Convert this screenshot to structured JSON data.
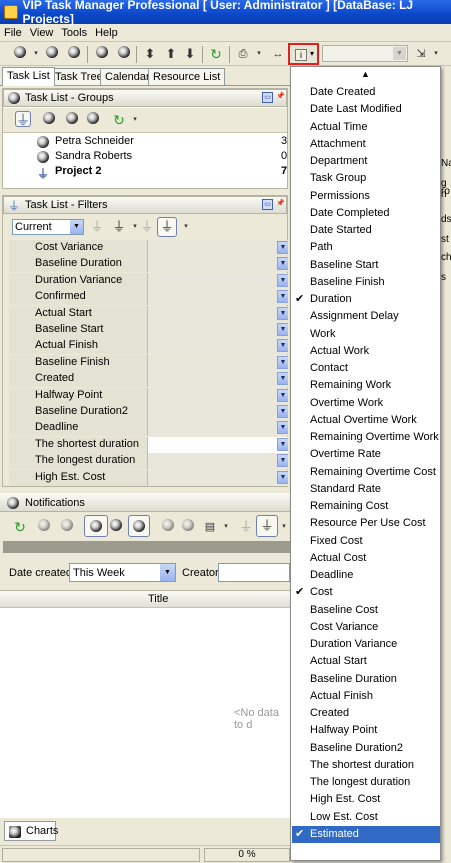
{
  "window": {
    "title": "VIP Task Manager Professional [ User: Administrator ] [DataBase: LJ Projects]"
  },
  "menubar": [
    "File",
    "View",
    "Tools",
    "Help"
  ],
  "tabs": [
    "Task List",
    "Task Tree",
    "Calendar",
    "Resource List"
  ],
  "groups_panel": {
    "title": "Task List - Groups",
    "rows": [
      {
        "name": "Petra Schneider",
        "count": "3"
      },
      {
        "name": "Sandra Roberts",
        "count": "0"
      },
      {
        "name": "Project 2",
        "count": "7"
      }
    ]
  },
  "filters_panel": {
    "title": "Task List - Filters",
    "filter_select": "Current",
    "rows": [
      "Cost Variance",
      "Baseline Duration",
      "Duration Variance",
      "Confirmed",
      "Actual Start",
      "Baseline Start",
      "Actual Finish",
      "Baseline Finish",
      "Created",
      "Halfway Point",
      "Baseline Duration2",
      "Deadline",
      "The shortest duration",
      "The longest duration",
      "High Est. Cost"
    ]
  },
  "notifications": {
    "title": "Notifications",
    "date_created_label": "Date created:",
    "date_created_value": "This Week",
    "creator_label": "Creator:",
    "column_title": "Title",
    "empty_text": "<No data to d"
  },
  "charts_tab": "Charts",
  "status": {
    "progress": "0 %"
  },
  "right_fragments": [
    "ro",
    "Na",
    "g n",
    "ds",
    "st",
    "ch",
    "s"
  ],
  "column_menu": {
    "items": [
      {
        "label": "Date Created",
        "checked": false
      },
      {
        "label": "Date Last Modified",
        "checked": false
      },
      {
        "label": "Actual Time",
        "checked": false
      },
      {
        "label": "Attachment",
        "checked": false
      },
      {
        "label": "Department",
        "checked": false
      },
      {
        "label": "Task Group",
        "checked": false
      },
      {
        "label": "Permissions",
        "checked": false
      },
      {
        "label": "Date Completed",
        "checked": false
      },
      {
        "label": "Date Started",
        "checked": false
      },
      {
        "label": "Path",
        "checked": false
      },
      {
        "label": "Baseline Start",
        "checked": false
      },
      {
        "label": "Baseline Finish",
        "checked": false
      },
      {
        "label": "Duration",
        "checked": true
      },
      {
        "label": "Assignment Delay",
        "checked": false
      },
      {
        "label": "Work",
        "checked": false
      },
      {
        "label": "Actual Work",
        "checked": false
      },
      {
        "label": "Contact",
        "checked": false
      },
      {
        "label": "Remaining Work",
        "checked": false
      },
      {
        "label": "Overtime Work",
        "checked": false
      },
      {
        "label": "Actual Overtime Work",
        "checked": false
      },
      {
        "label": "Remaining Overtime Work",
        "checked": false
      },
      {
        "label": "Overtime Rate",
        "checked": false
      },
      {
        "label": "Remaining Overtime Cost",
        "checked": false
      },
      {
        "label": "Standard Rate",
        "checked": false
      },
      {
        "label": "Remaining Cost",
        "checked": false
      },
      {
        "label": "Resource Per Use Cost",
        "checked": false
      },
      {
        "label": "Fixed Cost",
        "checked": false
      },
      {
        "label": "Actual Cost",
        "checked": false
      },
      {
        "label": "Deadline",
        "checked": false
      },
      {
        "label": "Cost",
        "checked": true
      },
      {
        "label": "Baseline Cost",
        "checked": false
      },
      {
        "label": "Cost Variance",
        "checked": false
      },
      {
        "label": "Duration Variance",
        "checked": false
      },
      {
        "label": "Actual Start",
        "checked": false
      },
      {
        "label": "Baseline Duration",
        "checked": false
      },
      {
        "label": "Actual Finish",
        "checked": false
      },
      {
        "label": "Created",
        "checked": false
      },
      {
        "label": "Halfway Point",
        "checked": false
      },
      {
        "label": "Baseline Duration2",
        "checked": false
      },
      {
        "label": "The shortest duration",
        "checked": false
      },
      {
        "label": "The longest duration",
        "checked": false
      },
      {
        "label": "High Est. Cost",
        "checked": false
      },
      {
        "label": "Low Est. Cost",
        "checked": false
      },
      {
        "label": "Estimated",
        "checked": true,
        "highlighted": true
      }
    ]
  },
  "colors": {
    "title_bar": "#0a47c9",
    "menu_highlight": "#316ac5",
    "highlight_box": "#e02020"
  }
}
